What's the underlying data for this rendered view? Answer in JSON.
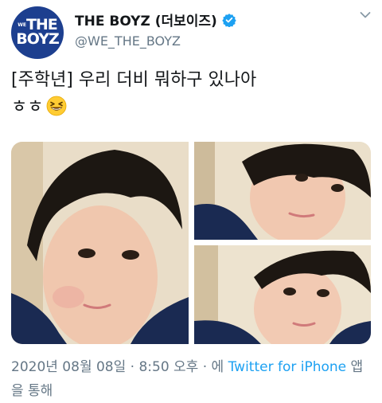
{
  "account": {
    "avatar_text_top": "THE",
    "avatar_text_we": "WE",
    "avatar_text_bottom": "BOYZ",
    "display_name": "THE BOYZ (더보이즈)",
    "handle": "@WE_THE_BOYZ",
    "verified": true
  },
  "icons": {
    "verified": "verified-badge-icon",
    "more": "chevron-down-icon",
    "emoji": "grinning-squinting-face-emoji"
  },
  "tweet": {
    "line1": "[주학년] 우리 더비 뭐하구 있나아",
    "line2": "ㅎㅎ",
    "photo_count": 3
  },
  "meta": {
    "date": "2020년 08월 08일 · 8:50 오후 · 에 ",
    "source": "Twitter for iPhone",
    "suffix": " 앱을 통해"
  },
  "colors": {
    "text": "#14171a",
    "secondary": "#657786",
    "link": "#1da1f2",
    "avatar_bg": "#1d3f8f",
    "verified": "#1da1f2"
  }
}
